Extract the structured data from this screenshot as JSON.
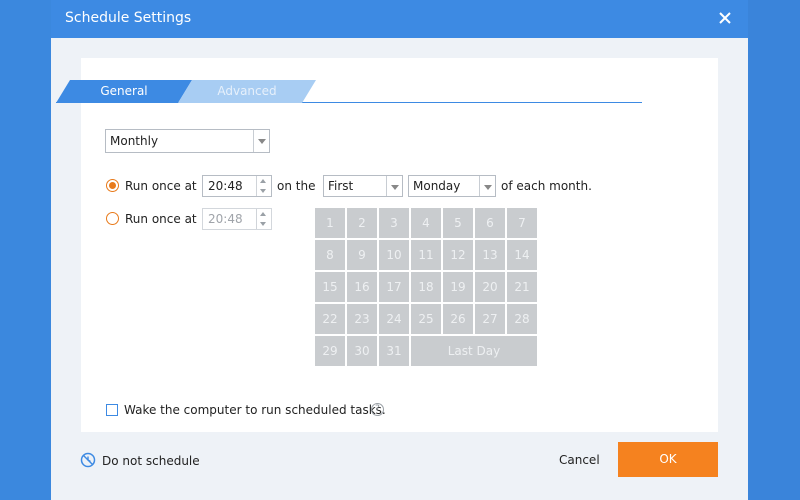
{
  "window": {
    "title": "Schedule Settings"
  },
  "tabs": [
    {
      "label": "General",
      "active": true
    },
    {
      "label": "Advanced",
      "active": false
    }
  ],
  "frequency": {
    "selected": "Monthly"
  },
  "option1": {
    "label": "Run once at",
    "time": "20:48",
    "on_the_label": "on the",
    "ordinal": "First",
    "weekday": "Monday",
    "suffix": "of each month.",
    "checked": true
  },
  "option2": {
    "label": "Run once at",
    "time": "20:48",
    "checked": false
  },
  "calendar": {
    "days": [
      "1",
      "2",
      "3",
      "4",
      "5",
      "6",
      "7",
      "8",
      "9",
      "10",
      "11",
      "12",
      "13",
      "14",
      "15",
      "16",
      "17",
      "18",
      "19",
      "20",
      "21",
      "22",
      "23",
      "24",
      "25",
      "26",
      "27",
      "28",
      "29",
      "30",
      "31"
    ],
    "last_day_label": "Last Day"
  },
  "wake": {
    "label": "Wake the computer to run scheduled tasks.",
    "checked": false,
    "help_icon": "?"
  },
  "footer": {
    "do_not_schedule": "Do not schedule",
    "cancel": "Cancel",
    "ok": "OK"
  },
  "colors": {
    "accent_blue": "#3d8ae3",
    "ok_orange": "#f5821f",
    "radio_orange": "#e87a1b",
    "calendar_cell": "#c9cccf"
  }
}
